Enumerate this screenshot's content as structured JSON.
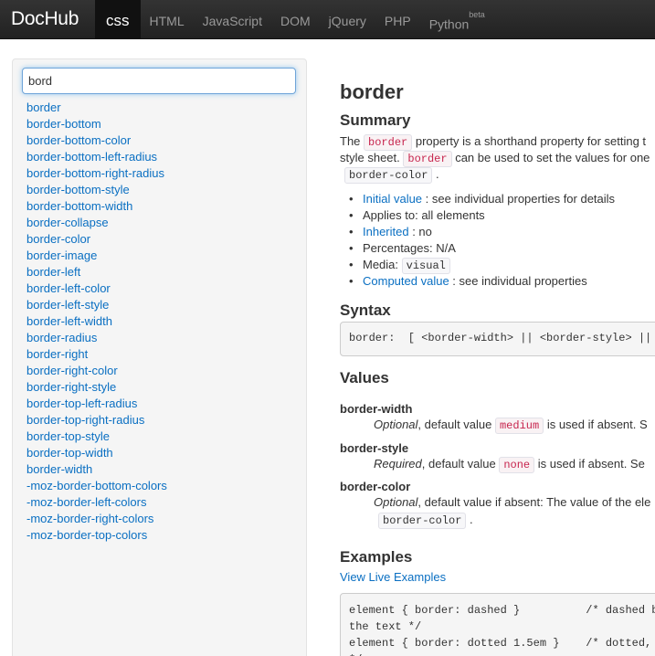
{
  "brand": "DocHub",
  "nav": {
    "items": [
      {
        "label": "css",
        "active": true
      },
      {
        "label": "HTML",
        "active": false
      },
      {
        "label": "JavaScript",
        "active": false
      },
      {
        "label": "DOM",
        "active": false
      },
      {
        "label": "jQuery",
        "active": false
      },
      {
        "label": "PHP",
        "active": false
      },
      {
        "label": "Python",
        "active": false,
        "sup": "beta"
      }
    ]
  },
  "sidebar": {
    "search_value": "bord",
    "results": [
      "border",
      "border-bottom",
      "border-bottom-color",
      "border-bottom-left-radius",
      "border-bottom-right-radius",
      "border-bottom-style",
      "border-bottom-width",
      "border-collapse",
      "border-color",
      "border-image",
      "border-left",
      "border-left-color",
      "border-left-style",
      "border-left-width",
      "border-radius",
      "border-right",
      "border-right-color",
      "border-right-style",
      "border-top-left-radius",
      "border-top-right-radius",
      "border-top-style",
      "border-top-width",
      "border-width",
      "-moz-border-bottom-colors",
      "-moz-border-left-colors",
      "-moz-border-right-colors",
      "-moz-border-top-colors"
    ]
  },
  "doc": {
    "title": "border",
    "summary_heading": "Summary",
    "summary": {
      "p1_a": "The ",
      "p1_code": "border",
      "p1_b": " property is a shorthand property for setting t",
      "p2_a": "style sheet. ",
      "p2_code": "border",
      "p2_b": " can be used to set the values for one",
      "p3_code": "border-color",
      "p3_b": " ."
    },
    "bullets": {
      "initial_link": "Initial value",
      "initial_text": " : see individual properties for details",
      "applies": "Applies to: all elements",
      "inherited_link": "Inherited",
      "inherited_text": " : no",
      "percentages": "Percentages: N/A",
      "media_label": "Media: ",
      "media_code": "visual",
      "computed_link": "Computed value",
      "computed_text": " : see individual properties"
    },
    "syntax_heading": "Syntax",
    "syntax_code": "border:  [ <border-width> || <border-style> ||",
    "values_heading": "Values",
    "values": {
      "w_term": "border-width",
      "w_em": "Optional",
      "w_a": ", default value ",
      "w_code": "medium",
      "w_b": " is used if absent. S",
      "s_term": "border-style",
      "s_em": "Required",
      "s_a": ", default value ",
      "s_code": "none",
      "s_b": " is used if absent. Se",
      "c_term": "border-color",
      "c_em": "Optional",
      "c_a": ", default value if absent: The value of the ele",
      "c_code": "border-color",
      "c_b": " ."
    },
    "examples_heading": "Examples",
    "examples_link": "View Live Examples",
    "examples_code": "element { border: dashed }          /* dashed b\nthe text */\nelement { border: dotted 1.5em }    /* dotted,\n*/"
  }
}
